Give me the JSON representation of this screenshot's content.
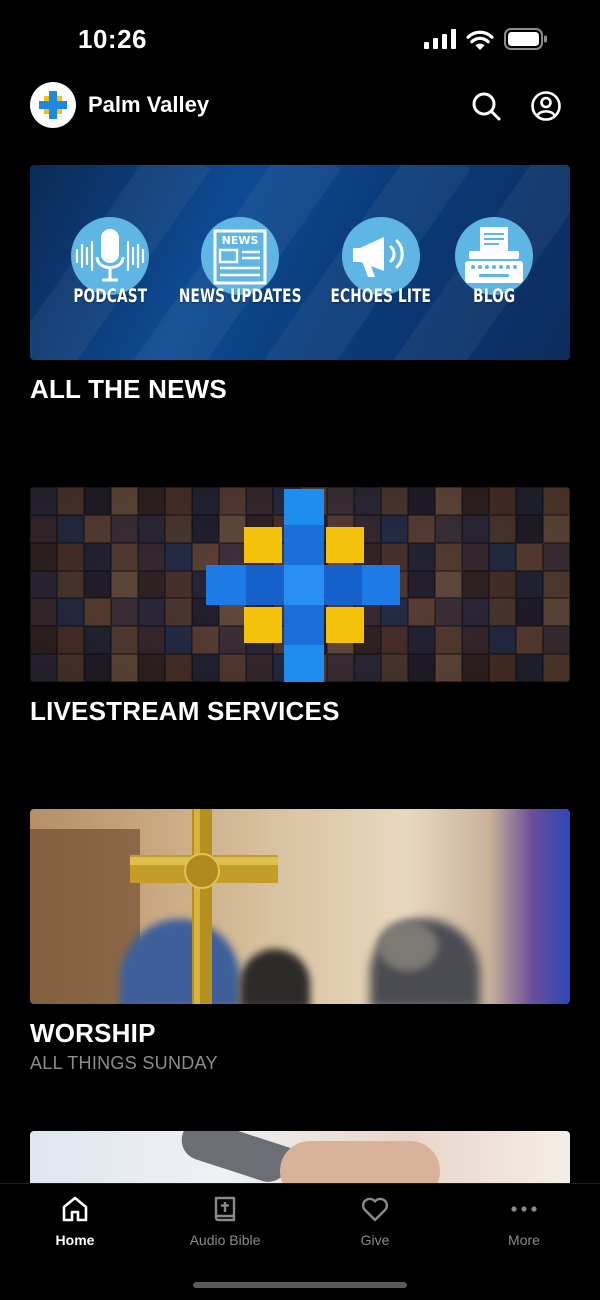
{
  "status_bar": {
    "time": "10:26"
  },
  "header": {
    "title": "Palm Valley"
  },
  "cards": [
    {
      "title": "ALL THE NEWS",
      "banner_items": [
        "PODCAST",
        "NEWS UPDATES",
        "ECHOES LITE",
        "BLOG"
      ],
      "newspaper_masthead": "NEWS"
    },
    {
      "title": "LIVESTREAM SERVICES"
    },
    {
      "title": "WORSHIP",
      "subtitle": "ALL THINGS SUNDAY"
    }
  ],
  "bottom_nav": [
    {
      "label": "Home",
      "icon": "home-icon",
      "active": true
    },
    {
      "label": "Audio Bible",
      "icon": "bible-icon",
      "active": false
    },
    {
      "label": "Give",
      "icon": "heart-icon",
      "active": false
    },
    {
      "label": "More",
      "icon": "more-icon",
      "active": false
    }
  ],
  "colors": {
    "background": "#000000",
    "brand_blue": "#1e88e5",
    "brand_yellow": "#f5c20b",
    "banner_blue": "#0e4a93",
    "icon_circle": "#5fb5e3",
    "muted_text": "#8c8c8c"
  }
}
